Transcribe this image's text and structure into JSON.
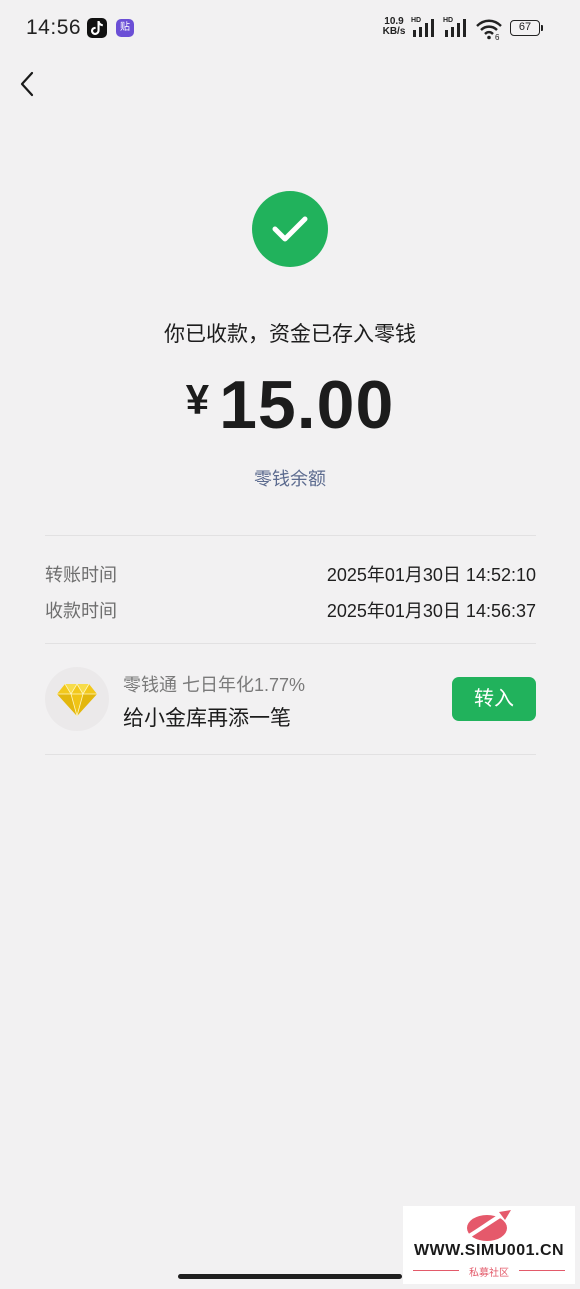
{
  "status_bar": {
    "time": "14:56",
    "app_badge": "贴",
    "net_speed_value": "10.9",
    "net_speed_unit": "KB/s",
    "hd_label_1": "HD",
    "hd_label_2": "HD",
    "wifi_label": "6",
    "battery": "67"
  },
  "result": {
    "headline": "你已收款，资金已存入零钱",
    "currency": "¥",
    "amount": "15.00",
    "balance_link": "零钱余额"
  },
  "details": [
    {
      "label": "转账时间",
      "value": "2025年01月30日 14:52:10"
    },
    {
      "label": "收款时间",
      "value": "2025年01月30日 14:56:37"
    }
  ],
  "promo": {
    "subtitle": "零钱通 七日年化1.77%",
    "title": "给小金库再添一笔",
    "button_label": "转入"
  },
  "watermark": {
    "url": "WWW.SIMU001.CN",
    "text": "私募社区"
  },
  "colors": {
    "accent_green": "#21b25c",
    "link_blue": "#5c6b8f",
    "background": "#f2f1f2"
  }
}
